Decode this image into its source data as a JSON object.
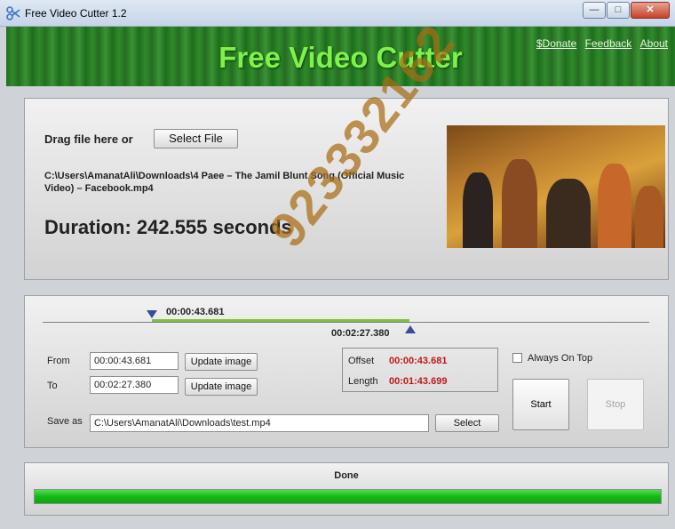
{
  "window": {
    "title": "Free Video Cutter 1.2"
  },
  "header": {
    "title": "Free Video Cutter",
    "links": [
      "$Donate",
      "Feedback",
      "About"
    ]
  },
  "file": {
    "drag_label": "Drag file here or",
    "select_file_label": "Select File",
    "path": "C:\\Users\\AmanatAli\\Downloads\\4 Paee – The Jamil Blunt Song (Official Music Video) – Facebook.mp4",
    "duration": "Duration: 242.555 seconds"
  },
  "timeline": {
    "start": "00:00:43.681",
    "end": "00:02:27.380"
  },
  "cut": {
    "from_label": "From",
    "from_value": "00:00:43.681",
    "to_label": "To",
    "to_value": "00:02:27.380",
    "update_image_label": "Update image",
    "offset_label": "Offset",
    "offset_value": "00:00:43.681",
    "length_label": "Length",
    "length_value": "00:01:43.699",
    "always_on_top_label": "Always On Top",
    "always_on_top_checked": false,
    "save_as_label": "Save as",
    "save_as_value": "C:\\Users\\AmanatAli\\Downloads\\test.mp4",
    "select_label": "Select",
    "start_label": "Start",
    "stop_label": "Stop"
  },
  "status": {
    "text": "Done",
    "progress": 1.0
  },
  "watermark": "923332162",
  "colors": {
    "accent_green": "#7ff24a",
    "value_red": "#c01818",
    "progress_green": "#16b816"
  }
}
